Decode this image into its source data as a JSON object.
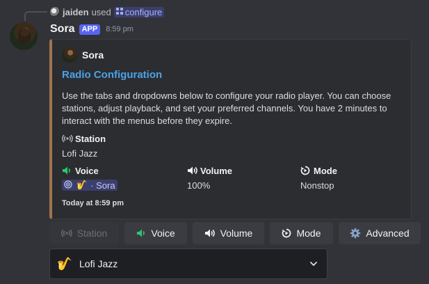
{
  "interaction": {
    "user": "jaiden",
    "used_text": "used",
    "command": "configure"
  },
  "message": {
    "author": "Sora",
    "badge": "APP",
    "timestamp": "8:59 pm"
  },
  "embed": {
    "accent_color": "#a0744d",
    "author_name": "Sora",
    "title": "Radio Configuration",
    "description": "Use the tabs and dropdowns below to configure your radio player. You can choose stations, adjust playback, and set your preferred channels. You have 2 minutes to interact with the menus before they expire.",
    "fields": {
      "station": {
        "name": "Station",
        "value": "Lofi Jazz",
        "icon": "broadcast-icon"
      },
      "voice": {
        "name": "Voice",
        "icon": "speaker-green-icon",
        "channel_emoji": "🎷",
        "channel_name": "· Sora"
      },
      "volume": {
        "name": "Volume",
        "value": "100%",
        "icon": "speaker-icon"
      },
      "mode": {
        "name": "Mode",
        "value": "Nonstop",
        "icon": "mode-icon"
      }
    },
    "footer": "Today at 8:59 pm"
  },
  "tabs": [
    {
      "label": "Station",
      "icon": "broadcast-icon",
      "disabled": true
    },
    {
      "label": "Voice",
      "icon": "speaker-green-icon",
      "disabled": false
    },
    {
      "label": "Volume",
      "icon": "speaker-icon",
      "disabled": false
    },
    {
      "label": "Mode",
      "icon": "mode-icon",
      "disabled": false
    },
    {
      "label": "Advanced",
      "icon": "gear-icon",
      "disabled": false
    }
  ],
  "select": {
    "emoji": "🎷",
    "selected": "Lofi Jazz"
  },
  "colors": {
    "background": "#323339",
    "embed_bg": "#2b2d31",
    "link": "#4aa3e8",
    "badge": "#5865f2",
    "voice_green": "#2dc770"
  }
}
